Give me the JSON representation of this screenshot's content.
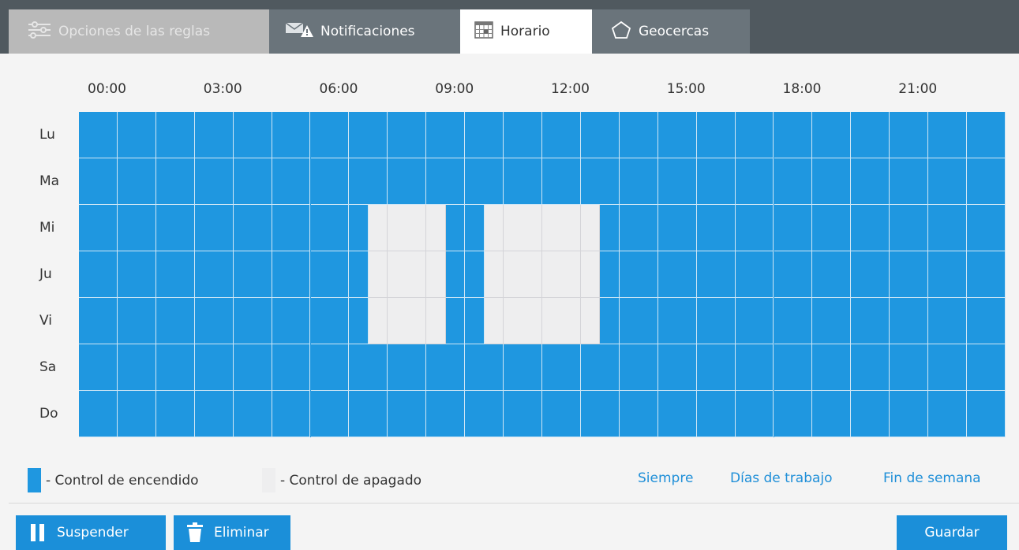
{
  "tabs": {
    "opciones": "Opciones de las reglas",
    "notificaciones": "Notificaciones",
    "horario": "Horario",
    "geocercas": "Geocercas"
  },
  "schedule": {
    "hours": [
      "00:00",
      "03:00",
      "06:00",
      "09:00",
      "12:00",
      "15:00",
      "18:00",
      "21:00"
    ],
    "days": [
      "Lu",
      "Ma",
      "Mi",
      "Ju",
      "Vi",
      "Sa",
      "Do"
    ],
    "off_slots": [
      {
        "days": [
          "Mi",
          "Ju",
          "Vi"
        ],
        "from_hour": 7.5,
        "to_hour": 9.5
      },
      {
        "days": [
          "Mi",
          "Ju",
          "Vi"
        ],
        "from_hour": 10.5,
        "to_hour": 13.5
      }
    ],
    "colors": {
      "on": "#1f97e0",
      "off": "#eeeeef"
    }
  },
  "legend": {
    "on_label": "- Control de encendido",
    "off_label": "- Control de apagado"
  },
  "presets": {
    "siempre": "Siempre",
    "dias_trabajo": "Días de trabajo",
    "fin_semana": "Fin de semana"
  },
  "buttons": {
    "suspender": "Suspender",
    "eliminar": "Eliminar",
    "guardar": "Guardar"
  },
  "colors": {
    "accent": "#1b8fd9",
    "tabbar": "#50595f"
  }
}
